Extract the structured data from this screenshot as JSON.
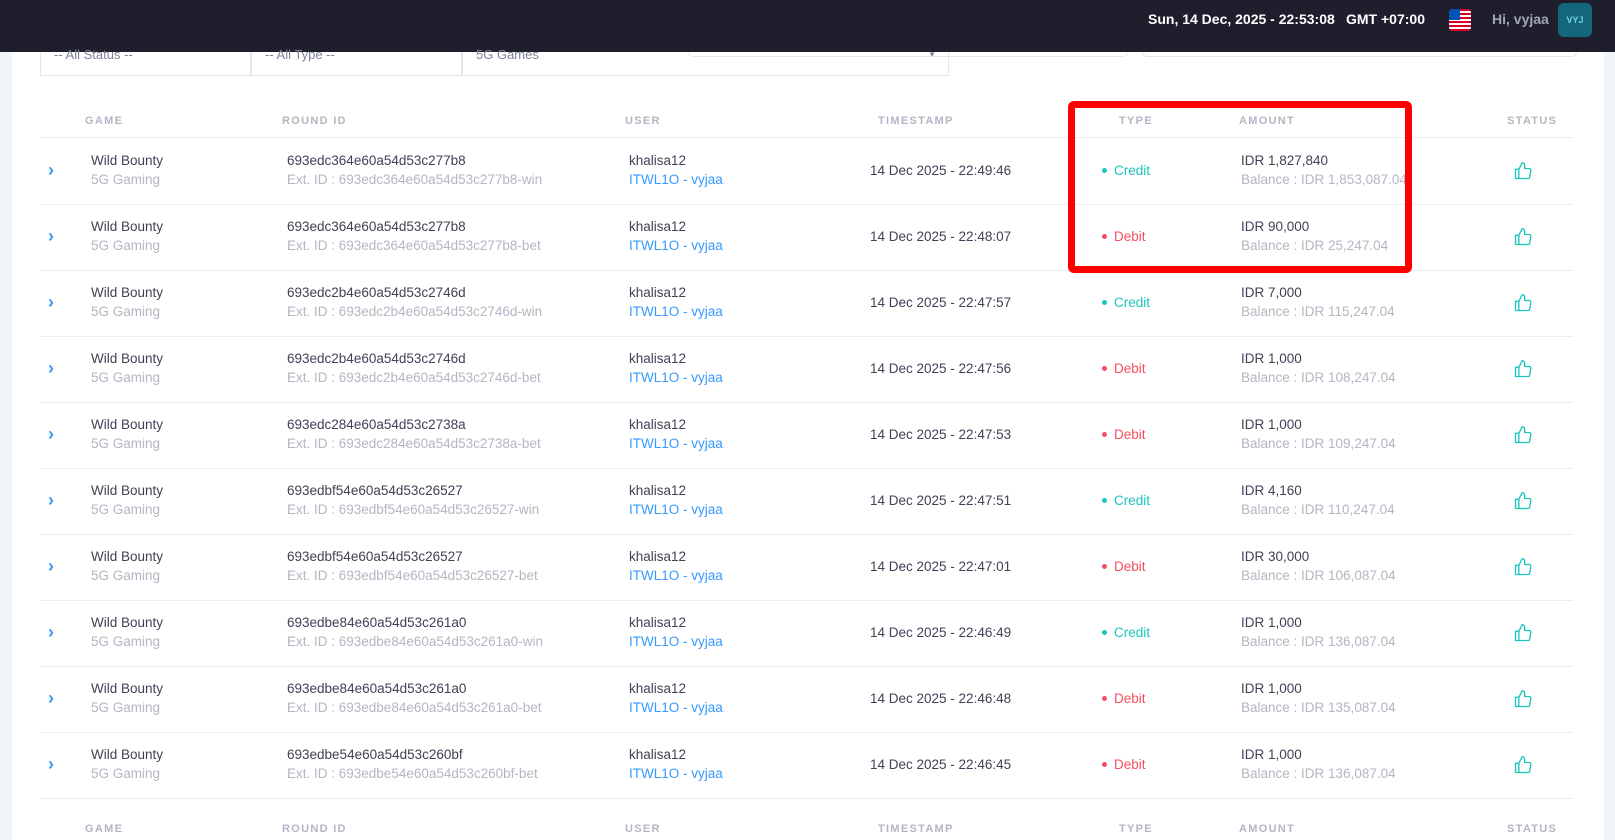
{
  "header": {
    "datetime": "Sun, 14 Dec, 2025 - 22:53:08",
    "timezone": "GMT +07:00",
    "greeting_prefix": "Hi, ",
    "username": "vyjaa",
    "avatar_initials": "VYJ"
  },
  "filters": {
    "status": "-- All Status --",
    "type": "-- All Type --",
    "provider": "5G Games"
  },
  "columns": {
    "game": "GAME",
    "round_id": "ROUND ID",
    "user": "USER",
    "timestamp": "TIMESTAMP",
    "type": "TYPE",
    "amount": "AMOUNT",
    "status": "STATUS"
  },
  "rows": [
    {
      "game": "Wild Bounty",
      "provider": "5G Gaming",
      "round_id": "693edc364e60a54d53c277b8",
      "ext_id": "Ext. ID : 693edc364e60a54d53c277b8-win",
      "user": "khalisa12",
      "agent": "ITWL1O - vyjaa",
      "timestamp": "14 Dec 2025 - 22:49:46",
      "type": "Credit",
      "amount": "IDR 1,827,840",
      "balance": "Balance : IDR 1,853,087.04"
    },
    {
      "game": "Wild Bounty",
      "provider": "5G Gaming",
      "round_id": "693edc364e60a54d53c277b8",
      "ext_id": "Ext. ID : 693edc364e60a54d53c277b8-bet",
      "user": "khalisa12",
      "agent": "ITWL1O - vyjaa",
      "timestamp": "14 Dec 2025 - 22:48:07",
      "type": "Debit",
      "amount": "IDR 90,000",
      "balance": "Balance : IDR 25,247.04"
    },
    {
      "game": "Wild Bounty",
      "provider": "5G Gaming",
      "round_id": "693edc2b4e60a54d53c2746d",
      "ext_id": "Ext. ID : 693edc2b4e60a54d53c2746d-win",
      "user": "khalisa12",
      "agent": "ITWL1O - vyjaa",
      "timestamp": "14 Dec 2025 - 22:47:57",
      "type": "Credit",
      "amount": "IDR 7,000",
      "balance": "Balance : IDR 115,247.04"
    },
    {
      "game": "Wild Bounty",
      "provider": "5G Gaming",
      "round_id": "693edc2b4e60a54d53c2746d",
      "ext_id": "Ext. ID : 693edc2b4e60a54d53c2746d-bet",
      "user": "khalisa12",
      "agent": "ITWL1O - vyjaa",
      "timestamp": "14 Dec 2025 - 22:47:56",
      "type": "Debit",
      "amount": "IDR 1,000",
      "balance": "Balance : IDR 108,247.04"
    },
    {
      "game": "Wild Bounty",
      "provider": "5G Gaming",
      "round_id": "693edc284e60a54d53c2738a",
      "ext_id": "Ext. ID : 693edc284e60a54d53c2738a-bet",
      "user": "khalisa12",
      "agent": "ITWL1O - vyjaa",
      "timestamp": "14 Dec 2025 - 22:47:53",
      "type": "Debit",
      "amount": "IDR 1,000",
      "balance": "Balance : IDR 109,247.04"
    },
    {
      "game": "Wild Bounty",
      "provider": "5G Gaming",
      "round_id": "693edbf54e60a54d53c26527",
      "ext_id": "Ext. ID : 693edbf54e60a54d53c26527-win",
      "user": "khalisa12",
      "agent": "ITWL1O - vyjaa",
      "timestamp": "14 Dec 2025 - 22:47:51",
      "type": "Credit",
      "amount": "IDR 4,160",
      "balance": "Balance : IDR 110,247.04"
    },
    {
      "game": "Wild Bounty",
      "provider": "5G Gaming",
      "round_id": "693edbf54e60a54d53c26527",
      "ext_id": "Ext. ID : 693edbf54e60a54d53c26527-bet",
      "user": "khalisa12",
      "agent": "ITWL1O - vyjaa",
      "timestamp": "14 Dec 2025 - 22:47:01",
      "type": "Debit",
      "amount": "IDR 30,000",
      "balance": "Balance : IDR 106,087.04"
    },
    {
      "game": "Wild Bounty",
      "provider": "5G Gaming",
      "round_id": "693edbe84e60a54d53c261a0",
      "ext_id": "Ext. ID : 693edbe84e60a54d53c261a0-win",
      "user": "khalisa12",
      "agent": "ITWL1O - vyjaa",
      "timestamp": "14 Dec 2025 - 22:46:49",
      "type": "Credit",
      "amount": "IDR 1,000",
      "balance": "Balance : IDR 136,087.04"
    },
    {
      "game": "Wild Bounty",
      "provider": "5G Gaming",
      "round_id": "693edbe84e60a54d53c261a0",
      "ext_id": "Ext. ID : 693edbe84e60a54d53c261a0-bet",
      "user": "khalisa12",
      "agent": "ITWL1O - vyjaa",
      "timestamp": "14 Dec 2025 - 22:46:48",
      "type": "Debit",
      "amount": "IDR 1,000",
      "balance": "Balance : IDR 135,087.04"
    },
    {
      "game": "Wild Bounty",
      "provider": "5G Gaming",
      "round_id": "693edbe54e60a54d53c260bf",
      "ext_id": "Ext. ID : 693edbe54e60a54d53c260bf-bet",
      "user": "khalisa12",
      "agent": "ITWL1O - vyjaa",
      "timestamp": "14 Dec 2025 - 22:46:45",
      "type": "Debit",
      "amount": "IDR 1,000",
      "balance": "Balance : IDR 136,087.04"
    }
  ],
  "icons": {
    "expand": "chevron-right-icon",
    "status": "thumbs-up-icon",
    "flag": "us-flag-icon"
  },
  "colors": {
    "credit": "#1bc5bd",
    "debit": "#f64e60",
    "link": "#3699ff",
    "highlight": "#ff0000",
    "topbar": "#1e1e2d"
  }
}
